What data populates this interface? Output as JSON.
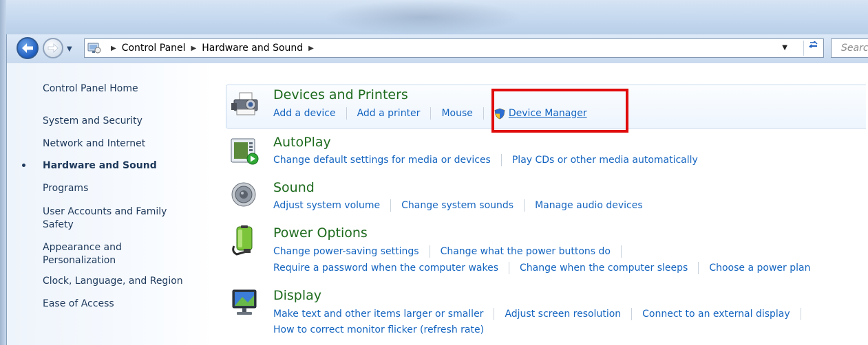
{
  "address_bar": {
    "crumbs": [
      "Control Panel",
      "Hardware and Sound"
    ],
    "search_placeholder": "Search Control Panel"
  },
  "sidebar": {
    "items": [
      {
        "label": "Control Panel Home"
      },
      {
        "label": "System and Security"
      },
      {
        "label": "Network and Internet"
      },
      {
        "label": "Hardware and Sound",
        "active": true
      },
      {
        "label": "Programs"
      },
      {
        "label": "User Accounts and Family Safety"
      },
      {
        "label": "Appearance and Personalization"
      },
      {
        "label": "Clock, Language, and Region"
      },
      {
        "label": "Ease of Access"
      }
    ]
  },
  "categories": [
    {
      "title": "Devices and Printers",
      "icon": "printer-icon",
      "links": [
        "Add a device",
        "Add a printer",
        "Mouse",
        "Device Manager"
      ]
    },
    {
      "title": "AutoPlay",
      "icon": "autoplay-icon",
      "links": [
        "Change default settings for media or devices",
        "Play CDs or other media automatically"
      ]
    },
    {
      "title": "Sound",
      "icon": "speaker-icon",
      "links": [
        "Adjust system volume",
        "Change system sounds",
        "Manage audio devices"
      ]
    },
    {
      "title": "Power Options",
      "icon": "battery-icon",
      "links": [
        "Change power-saving settings",
        "Change what the power buttons do",
        "Require a password when the computer wakes",
        "Change when the computer sleeps",
        "Choose a power plan"
      ]
    },
    {
      "title": "Display",
      "icon": "monitor-icon",
      "links": [
        "Make text and other items larger or smaller",
        "Adjust screen resolution",
        "Connect to an external display",
        "How to correct monitor flicker (refresh rate)"
      ]
    }
  ],
  "colors": {
    "link": "#1565c0",
    "category_title": "#1e6b1e",
    "annotation_box": "#e00b0b"
  }
}
